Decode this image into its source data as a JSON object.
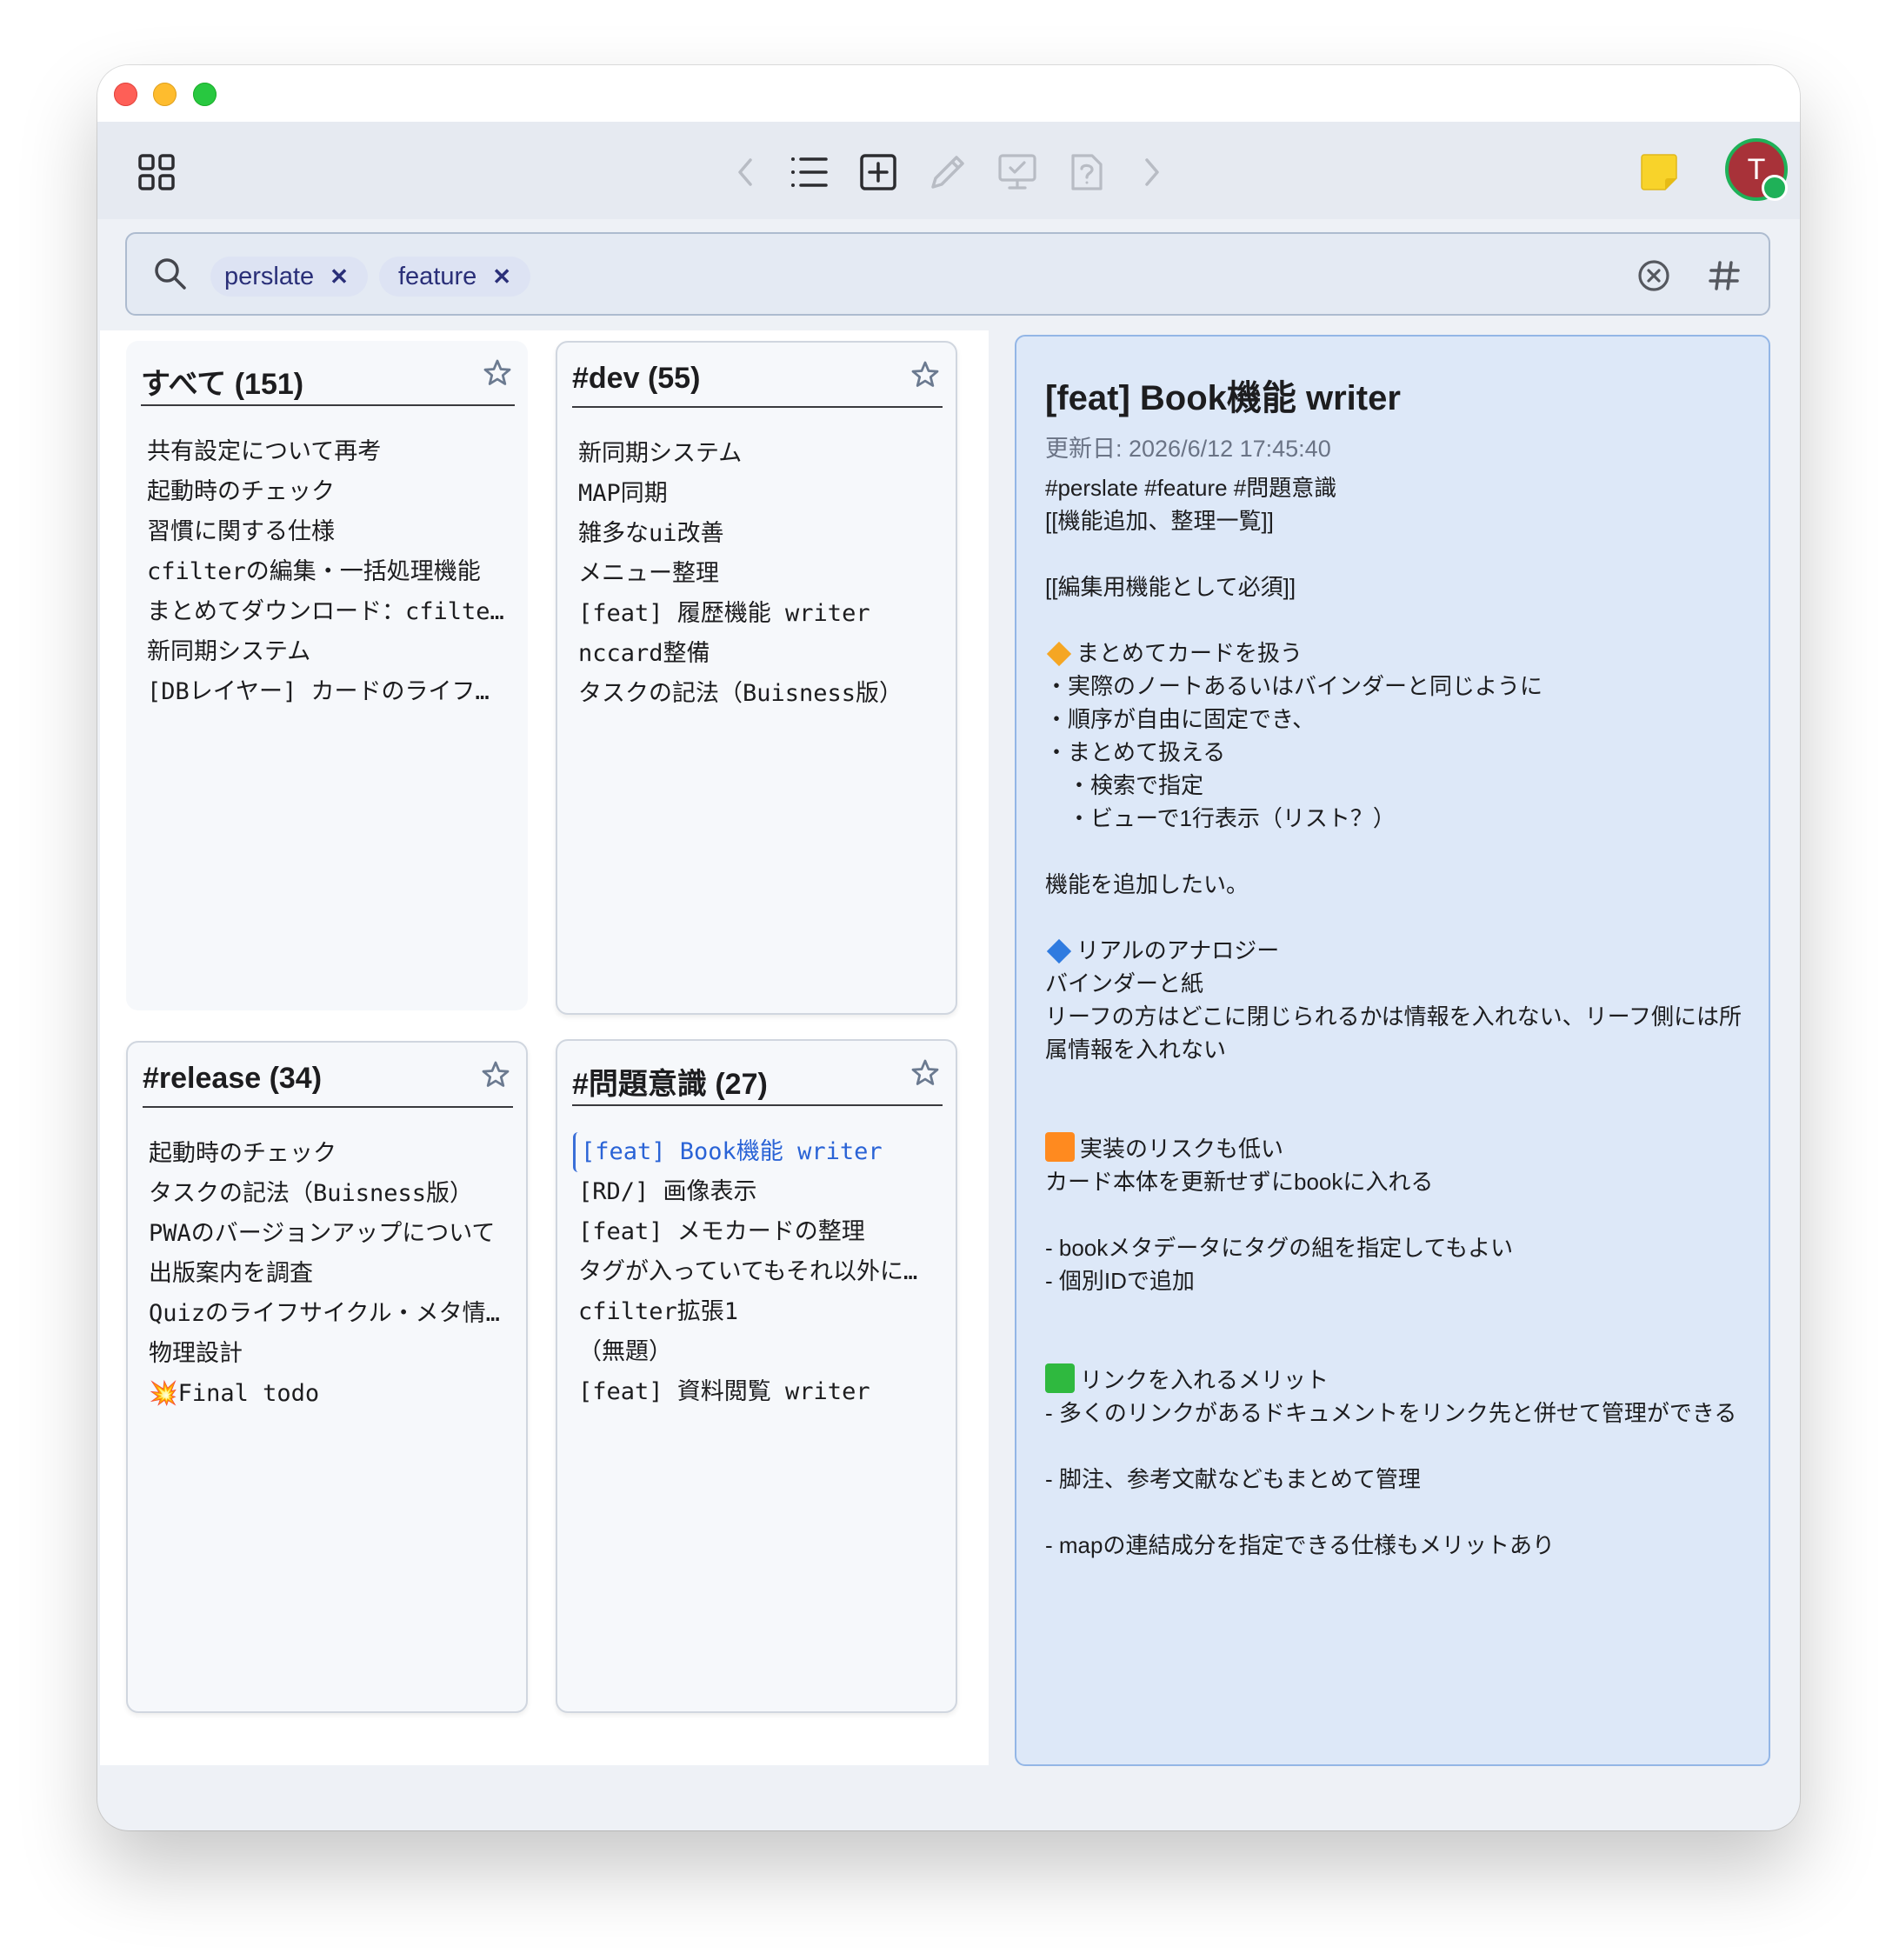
{
  "toolbar": {
    "icons": [
      "grid-icon",
      "chevron-left-icon",
      "list-icon",
      "add-card-icon",
      "pencil-icon",
      "presentation-icon",
      "help-card-icon",
      "chevron-right-icon",
      "note-icon"
    ],
    "avatar_letter": "T"
  },
  "search": {
    "chips": [
      {
        "label": "perslate"
      },
      {
        "label": "feature"
      }
    ],
    "remove_symbol": "✕"
  },
  "cards": [
    {
      "title": "すべて (151)",
      "items": [
        "共有設定について再考",
        "起動時のチェック",
        "習慣に関する仕様",
        "cfilterの編集・一括処理機能",
        "まとめてダウンロード：cfilte…",
        "新同期システム",
        "[DBレイヤー] カードのライフサ…"
      ]
    },
    {
      "title": "#dev (55)",
      "items": [
        "新同期システム",
        "MAP同期",
        "雑多なui改善",
        "メニュー整理",
        "[feat] 履歴機能 writer",
        "nccard整備",
        "タスクの記法（Buisness版）"
      ]
    },
    {
      "title": "#release (34)",
      "items": [
        "起動時のチェック",
        "タスクの記法（Buisness版）",
        "PWAのバージョンアップについて",
        "出版案内を調査",
        "Quizのライフサイクル・メタ情報",
        "物理設計",
        "💥Final todo"
      ]
    },
    {
      "title": "#問題意識 (27)",
      "items": [
        "[feat] Book機能 writer",
        "[RD/] 画像表示",
        "[feat] メモカードの整理",
        "タグが入っていてもそれ以外に修…",
        "cfilter拡張1",
        "（無題）",
        "[feat] 資料閲覧 writer"
      ],
      "selected_index": 0
    }
  ],
  "detail": {
    "title": "[feat] Book機能 writer",
    "updated": "更新日: 2026/6/12 17:45:40",
    "lines": [
      "#perslate #feature #問題意識",
      "[[機能追加、整理一覧]]",
      "",
      "[[編集用機能として必須]]",
      "",
      "まとめてカードを扱う",
      "・実際のノートあるいはバインダーと同じように",
      "・順序が自由に固定でき、",
      "・まとめて扱える",
      "・検索で指定",
      "・ビューで1行表示（リスト？）",
      "",
      "機能を追加したい。",
      "",
      "リアルのアナロジー",
      "バインダーと紙",
      "リーフの方はどこに閉じられるかは情報を入れない、リーフ側には所属情報を入れない",
      "",
      "",
      "実装のリスクも低い",
      "カード本体を更新せずにbookに入れる",
      "",
      "- bookメタデータにタグの組を指定してもよい",
      "- 個別IDで追加",
      "",
      "",
      "リンクを入れるメリット",
      "- 多くのリンクがあるドキュメントをリンク先と併せて管理ができる",
      "",
      "- 脚注、参考文献などもまとめて管理",
      "",
      "- mapの連結成分を指定できる仕様もメリットあり"
    ],
    "bullet_colors": {
      "orange_diamond": "#f5a623",
      "blue_diamond": "#2f7be0",
      "orange_square": "#ff8a1f",
      "green_square": "#2fb93f"
    }
  },
  "colors": {
    "accent_blue": "#2a63d6",
    "note_yellow": "#f8d32a",
    "avatar_red": "#a83239",
    "status_green": "#1fb158"
  }
}
